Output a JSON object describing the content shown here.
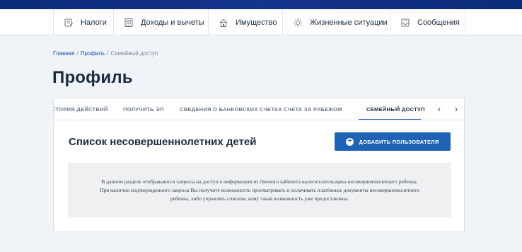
{
  "nav": {
    "items": [
      {
        "label": "Налоги",
        "icon": "tax-document-icon"
      },
      {
        "label": "Доходы и вычеты",
        "icon": "income-calculator-icon"
      },
      {
        "label": "Имущество",
        "icon": "house-icon"
      },
      {
        "label": "Жизненные ситуации",
        "icon": "life-situations-icon"
      },
      {
        "label": "Сообщения",
        "icon": "messages-icon"
      }
    ]
  },
  "breadcrumb": {
    "home": "Главная",
    "profile": "Профиль",
    "current": "Семейный доступ",
    "separator": "/"
  },
  "page": {
    "title": "Профиль"
  },
  "tabs": {
    "items": [
      {
        "label": "СТОРИЯ ДЕЙСТВИЙ"
      },
      {
        "label": "ПОЛУЧИТЬ ЭП"
      },
      {
        "label": "СВЕДЕНИЯ О БАНКОВСКИХ СЧЕТАХ"
      },
      {
        "label": "СЧЕТА ЗА РУБЕЖОМ"
      },
      {
        "label": "СЕМЕЙНЫЙ ДОСТУП"
      }
    ],
    "active": "СЕМЕЙНЫЙ ДОСТУП",
    "prev_arrow": "‹",
    "next_arrow": "›"
  },
  "section": {
    "title": "Список несовершеннолетних детей",
    "add_button_label": "ДОБАВИТЬ ПОЛЬЗОВАТЕЛЯ",
    "add_button_icon": "+",
    "info_lines": [
      "В данном разделе отображаются запросы на доступ к информации из Личного кабинета налогоплательщика несовершеннолетнего ребенка.",
      "При наличии подтвержденного запроса Вы получите возможность просматривать и оплачивать платёжные документы несовершеннолетнего",
      "ребенка, либо управлять списком, кому такая возможность уже предоставлена."
    ]
  },
  "colors": {
    "header_bar": "#0a2a7a",
    "accent": "#1e63b6",
    "link": "#1c4fa8",
    "background": "#f0f3f7"
  }
}
